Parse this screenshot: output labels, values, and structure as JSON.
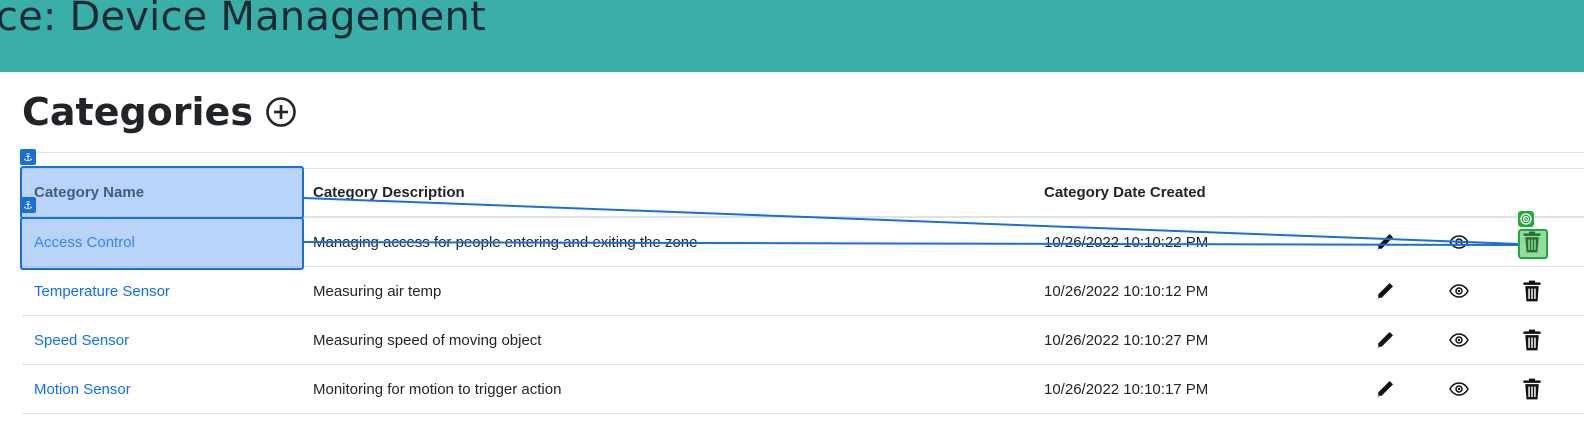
{
  "header": {
    "title": "ffice: Device Management"
  },
  "page": {
    "title": "Categories",
    "add_icon": "plus-circle-icon"
  },
  "table": {
    "columns": [
      "Category Name",
      "Category Description",
      "Category Date Created"
    ],
    "rows": [
      {
        "name": "Access Control",
        "description": "Managing access for people entering and exiting the zone",
        "created": "10/26/2022 10:10:22 PM"
      },
      {
        "name": "Temperature Sensor",
        "description": "Measuring air temp",
        "created": "10/26/2022 10:10:12 PM"
      },
      {
        "name": "Speed Sensor",
        "description": "Measuring speed of moving object",
        "created": "10/26/2022 10:10:27 PM"
      },
      {
        "name": "Motion Sensor",
        "description": "Monitoring for motion to trigger action",
        "created": "10/26/2022 10:10:17 PM"
      }
    ],
    "row_actions": [
      "pencil-icon",
      "eye-icon",
      "trash-icon"
    ]
  },
  "overlay": {
    "anchor_icon": "anchor-icon",
    "target_icon": "target-icon",
    "colors": {
      "anchor": "#1a6fd6",
      "target": "#1faa3a"
    }
  },
  "colors": {
    "topbar": "#3aafa9",
    "link": "#0d6efd"
  }
}
